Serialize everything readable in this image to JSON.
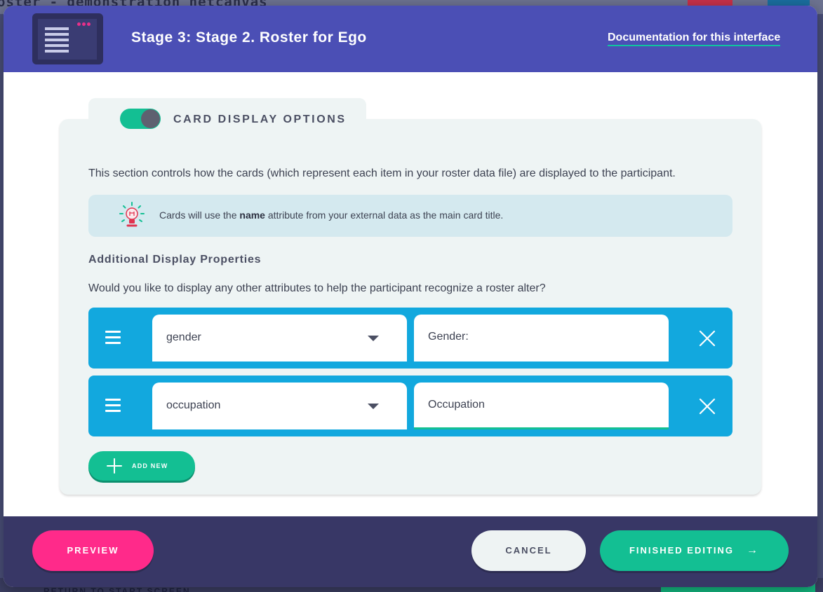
{
  "background": {
    "window_title": "oster - demonstration netcanvas",
    "return_label": "RETURN TO START SCREEN"
  },
  "header": {
    "stage_title": "Stage 3: Stage 2. Roster for Ego",
    "doc_link": "Documentation for this interface"
  },
  "section": {
    "heading": "CARD DISPLAY OPTIONS",
    "toggle_on": true,
    "description": "This section controls how the cards (which represent each item in your roster data file) are displayed to the participant.",
    "tip": {
      "before": "Cards will use the ",
      "bold": "name",
      "after": " attribute from your external data as the main card title."
    },
    "sub_heading": "Additional Display Properties",
    "question": "Would you like to display any other attributes to help the participant recognize a roster alter?"
  },
  "properties": [
    {
      "attribute": "gender",
      "label": "Gender:"
    },
    {
      "attribute": "occupation",
      "label": "Occupation"
    }
  ],
  "add_new_label": "ADD NEW",
  "footer": {
    "preview_label": "PREVIEW",
    "cancel_label": "CANCEL",
    "finish_label": "FINISHED EDITING"
  },
  "colors": {
    "header": "#4b4fb5",
    "accent_green": "#13bf93",
    "row_blue": "#12a8de",
    "preview_pink": "#ff2a8a",
    "footer": "#383766"
  }
}
